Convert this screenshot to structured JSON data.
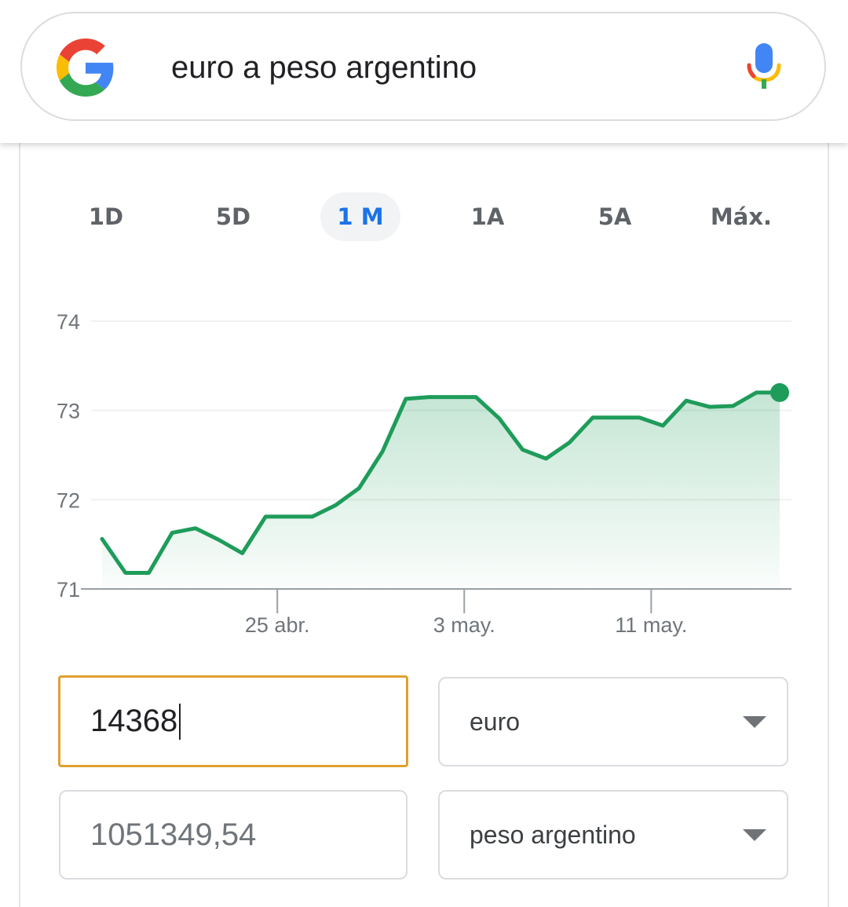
{
  "search": {
    "query": "euro a peso argentino",
    "logo_icon": "google-g-logo-icon",
    "mic_icon": "microphone-icon"
  },
  "range_tabs": [
    {
      "label": "1D",
      "active": false
    },
    {
      "label": "5D",
      "active": false
    },
    {
      "label": "1 M",
      "active": true
    },
    {
      "label": "1A",
      "active": false
    },
    {
      "label": "5A",
      "active": false
    },
    {
      "label": "Máx.",
      "active": false
    }
  ],
  "chart_data": {
    "type": "area",
    "title": "",
    "xlabel": "",
    "ylabel": "",
    "ylim": [
      71,
      74
    ],
    "y_ticks": [
      "74",
      "73",
      "72",
      "71"
    ],
    "x_tick_labels": [
      "25 abr.",
      "3 may.",
      "11 may."
    ],
    "x_tick_index": [
      7.5,
      15.5,
      23.5
    ],
    "series": [
      {
        "values": [
          71.56,
          71.18,
          71.18,
          71.63,
          71.68,
          71.55,
          71.4,
          71.81,
          71.81,
          71.81,
          71.94,
          72.13,
          72.54,
          73.13,
          73.15,
          73.15,
          73.15,
          72.91,
          72.56,
          72.46,
          72.64,
          72.92,
          72.92,
          72.92,
          72.83,
          73.11,
          73.04,
          73.05,
          73.2,
          73.2
        ]
      }
    ],
    "grid": true,
    "line_color": "#1e9c5a",
    "fill_color": "#1e9c5a",
    "last_point_marker": true
  },
  "converter": {
    "from_amount": "14368",
    "from_currency": "euro",
    "to_amount": "1051349,54",
    "to_currency": "peso argentino",
    "focus_color": "#e0a030"
  }
}
